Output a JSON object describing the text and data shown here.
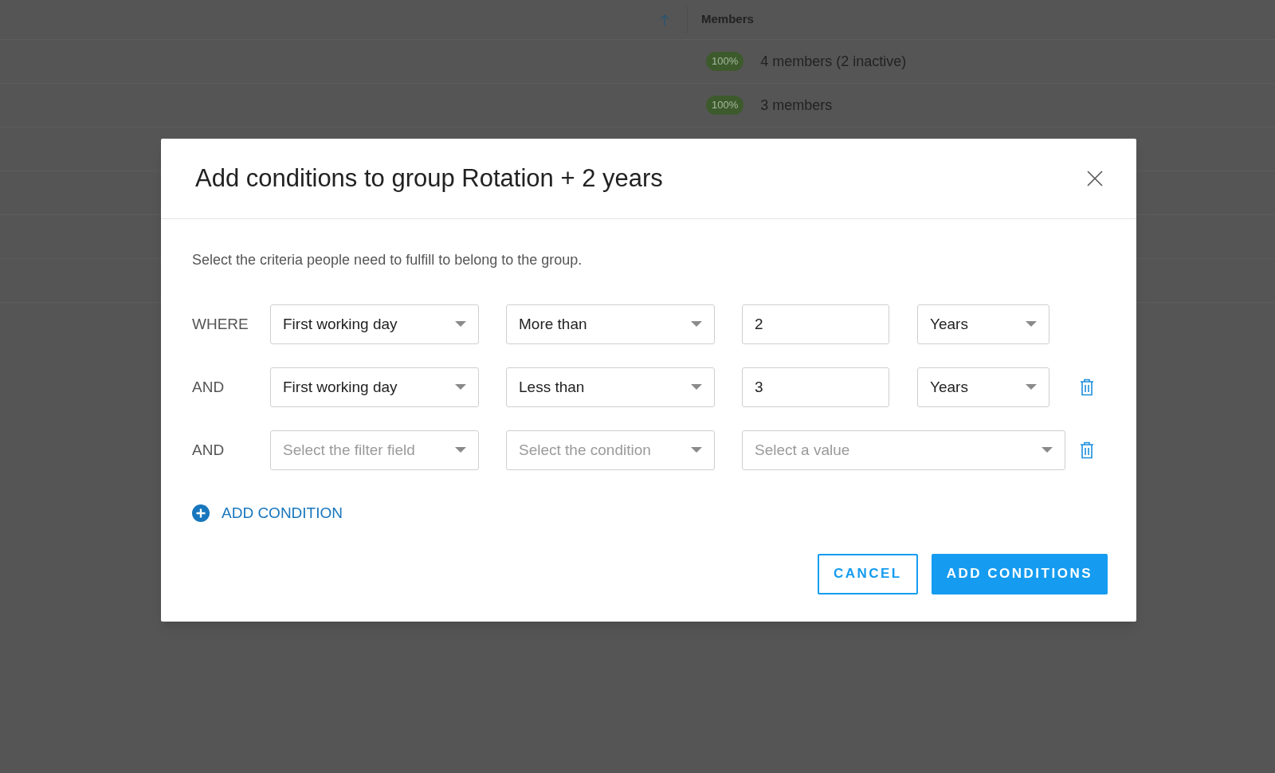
{
  "table": {
    "columns": [
      {
        "label": "Members",
        "sorted": true
      }
    ],
    "rows": [
      {
        "badge": "100%",
        "members": "4 members (2 inactive)"
      },
      {
        "badge": "100%",
        "members": "3 members"
      }
    ]
  },
  "dialog": {
    "title": "Add conditions to group Rotation + 2 years",
    "description": "Select the criteria people need to fulfill to belong to the group.",
    "conditions": [
      {
        "conjunction": "WHERE",
        "field": {
          "value": "First working day"
        },
        "operator": {
          "value": "More than"
        },
        "value": {
          "kind": "input",
          "value": "2"
        },
        "unit": {
          "value": "Years"
        },
        "deletable": false
      },
      {
        "conjunction": "AND",
        "field": {
          "value": "First working day"
        },
        "operator": {
          "value": "Less than"
        },
        "value": {
          "kind": "input",
          "value": "3"
        },
        "unit": {
          "value": "Years"
        },
        "deletable": true
      },
      {
        "conjunction": "AND",
        "field": {
          "placeholder": "Select the filter field"
        },
        "operator": {
          "placeholder": "Select the condition"
        },
        "value": {
          "kind": "select",
          "placeholder": "Select a value"
        },
        "deletable": true
      }
    ],
    "add_condition": "ADD CONDITION",
    "buttons": [
      {
        "kind": "secondary",
        "label": "CANCEL"
      },
      {
        "kind": "primary",
        "label": "ADD CONDITIONS"
      }
    ]
  }
}
